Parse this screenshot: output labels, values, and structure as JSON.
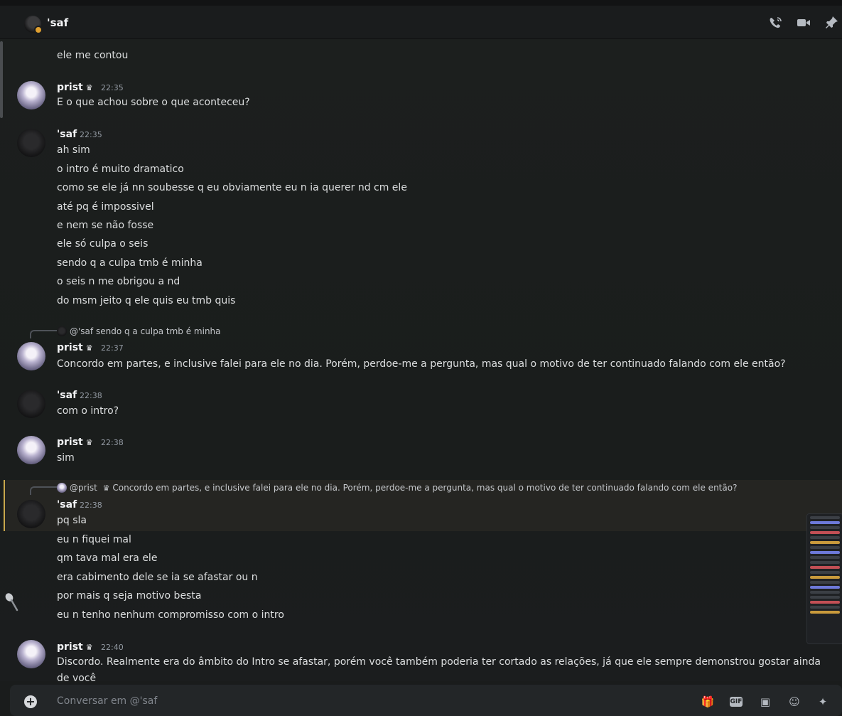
{
  "header": {
    "channel_name": "'saf",
    "icons": [
      "phone-call-icon",
      "video-camera-icon",
      "pin-icon"
    ]
  },
  "messages": {
    "prev_cut": "ele me contou",
    "m1": {
      "author": "prist",
      "badge": "crown-icon",
      "time": "22:35",
      "lines": [
        "E o que achou sobre o que aconteceu?"
      ]
    },
    "m2": {
      "author": "'saf",
      "time": "22:35",
      "lines": [
        "ah sim",
        "o intro é muito dramatico",
        "como se ele já nn soubesse q eu obviamente eu n ia querer nd cm ele",
        "até pq é impossivel",
        "e nem se não fosse",
        "ele só culpa o seis",
        "sendo q a culpa tmb é minha",
        "o seis n me obrigou a nd",
        "do msm jeito q ele quis eu tmb quis"
      ]
    },
    "m3": {
      "reply_to_author": "@'saf",
      "reply_text": "sendo q a culpa tmb é minha",
      "author": "prist",
      "time": "22:37",
      "lines": [
        "Concordo em partes, e inclusive falei para ele no dia. Porém, perdoe-me a pergunta, mas qual o motivo de ter continuado falando com ele então?"
      ]
    },
    "m4": {
      "author": "'saf",
      "time": "22:38",
      "lines": [
        "com o intro?"
      ]
    },
    "m5": {
      "author": "prist",
      "time": "22:38",
      "lines": [
        "sim"
      ]
    },
    "m6": {
      "reply_to_author": "@prist",
      "reply_text": "Concordo em partes, e inclusive falei para ele no dia. Porém, perdoe-me a pergunta, mas qual o motivo de ter continuado falando com ele então?",
      "author": "'saf",
      "time": "22:38",
      "lines": [
        "pq sla",
        "eu n fiquei mal",
        "qm tava mal era ele",
        "era cabimento dele se ia se afastar ou n",
        "por mais q seja motivo besta",
        "eu n tenho nenhum compromisso com o intro"
      ]
    },
    "m7": {
      "author": "prist",
      "time": "22:40",
      "text": "Discordo. Realmente era do âmbito do Intro se afastar, porém você também poderia ter cortado as relações, já que ele sempre demonstrou gostar ainda de você"
    }
  },
  "composer": {
    "placeholder": "Conversar em @'saf",
    "gif_label": "GIF",
    "icons": [
      "add-attachment-icon",
      "gift-icon",
      "gif-icon",
      "sticker-icon",
      "emoji-icon",
      "apps-icon"
    ]
  }
}
